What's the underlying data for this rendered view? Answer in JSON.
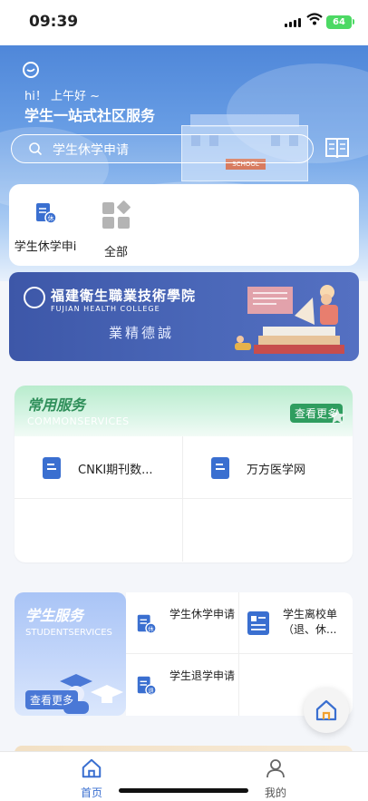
{
  "status_bar": {
    "time": "09:39",
    "battery": "64"
  },
  "hero": {
    "greeting": "hi！ 上午好 ~",
    "title": "学生一站式社区服务",
    "search_placeholder": "学生休学申请",
    "building_sign": "SCHOOL"
  },
  "quick_links": [
    {
      "label": "学生休学申i",
      "icon": "leave-doc-icon"
    },
    {
      "label": "全部",
      "icon": "grid-all-icon"
    }
  ],
  "banner": {
    "college_cn": "福建衛生職業技術學院",
    "college_en": "FUJIAN HEALTH COLLEGE",
    "motto": "業精德誠"
  },
  "common_services": {
    "title": "常用服务",
    "subtitle": "COMMONSERVICES",
    "more_label": "查看更多",
    "items": [
      {
        "label": "CNKI期刊数...",
        "icon": "document-icon"
      },
      {
        "label": "万方医学网",
        "icon": "document-icon"
      }
    ]
  },
  "student_services": {
    "title": "学生服务",
    "subtitle": "STUDENTSERVICES",
    "more_label": "查看更多",
    "items": [
      {
        "label": "学生休学申请",
        "icon": "leave-doc-icon"
      },
      {
        "label": "学生离校单（退、休...",
        "icon": "form-icon"
      },
      {
        "label": "学生退学申请",
        "icon": "withdraw-doc-icon"
      }
    ]
  },
  "tabbar": {
    "items": [
      {
        "label": "首页",
        "active": true
      },
      {
        "label": "我的",
        "active": false
      }
    ]
  },
  "colors": {
    "primary": "#3a6fd0",
    "green": "#2f9d5f",
    "active_tab": "#3a6fd0"
  }
}
